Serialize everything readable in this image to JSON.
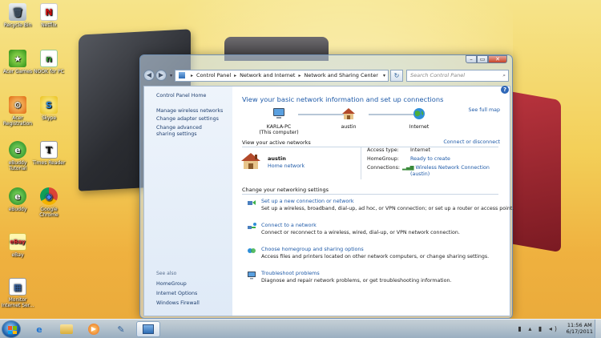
{
  "desktop": {
    "icons": [
      {
        "label": "Recycle Bin",
        "glyph": "🗑"
      },
      {
        "label": "Netflix",
        "glyph": "N"
      },
      {
        "label": "Acer Games",
        "glyph": "★"
      },
      {
        "label": "NOOK for PC",
        "glyph": "n"
      },
      {
        "label": "Acer Registration",
        "glyph": "⚙"
      },
      {
        "label": "Skype",
        "glyph": "S"
      },
      {
        "label": "eBuddy Tutorial",
        "glyph": "e"
      },
      {
        "label": "Times Reader",
        "glyph": "T"
      },
      {
        "label": "eBuddy",
        "glyph": "e"
      },
      {
        "label": "Google Chrome",
        "glyph": "◉"
      },
      {
        "label": "eBay",
        "glyph": "eBay"
      },
      {
        "label": "Monitor Internet Ser...",
        "glyph": "▦"
      }
    ]
  },
  "window": {
    "caption": {
      "minimize": "–",
      "maximize": "▭",
      "close": "✕"
    },
    "nav": {
      "back": "◀",
      "forward": "▶",
      "recent": "▾"
    },
    "breadcrumb": [
      "Control Panel",
      "Network and Internet",
      "Network and Sharing Center"
    ],
    "breadcrumb_sep": "▸",
    "refresh_glyph": "↻",
    "search_placeholder": "Search Control Panel",
    "help_glyph": "?",
    "left_pane": {
      "home": "Control Panel Home",
      "links": [
        "Manage wireless networks",
        "Change adapter settings",
        "Change advanced sharing settings"
      ],
      "see_also_title": "See also",
      "see_also": [
        "HomeGroup",
        "Internet Options",
        "Windows Firewall"
      ]
    },
    "main": {
      "title": "View your basic network information and set up connections",
      "see_full_map": "See full map",
      "map": [
        {
          "label": "KARLA-PC",
          "sub": "(This computer)"
        },
        {
          "label": "austin",
          "sub": ""
        },
        {
          "label": "Internet",
          "sub": ""
        }
      ],
      "active_title": "View your active networks",
      "connect_disconnect": "Connect or disconnect",
      "network_name": "austin",
      "network_type": "Home network",
      "props": {
        "access_type_label": "Access type:",
        "access_type": "Internet",
        "homegroup_label": "HomeGroup:",
        "homegroup": "Ready to create",
        "connections_label": "Connections:",
        "connections": "Wireless Network Connection",
        "connections_sub": "(austin)"
      },
      "settings_title": "Change your networking settings",
      "tasks": [
        {
          "title": "Set up a new connection or network",
          "desc": "Set up a wireless, broadband, dial-up, ad hoc, or VPN connection; or set up a router or access point."
        },
        {
          "title": "Connect to a network",
          "desc": "Connect or reconnect to a wireless, wired, dial-up, or VPN network connection."
        },
        {
          "title": "Choose homegroup and sharing options",
          "desc": "Access files and printers located on other network computers, or change sharing settings."
        },
        {
          "title": "Troubleshoot problems",
          "desc": "Diagnose and repair network problems, or get troubleshooting information."
        }
      ]
    }
  },
  "taskbar": {
    "tray": "▮ ▴ ▮ ◂)",
    "time": "11:56 AM",
    "date": "6/17/2011"
  }
}
